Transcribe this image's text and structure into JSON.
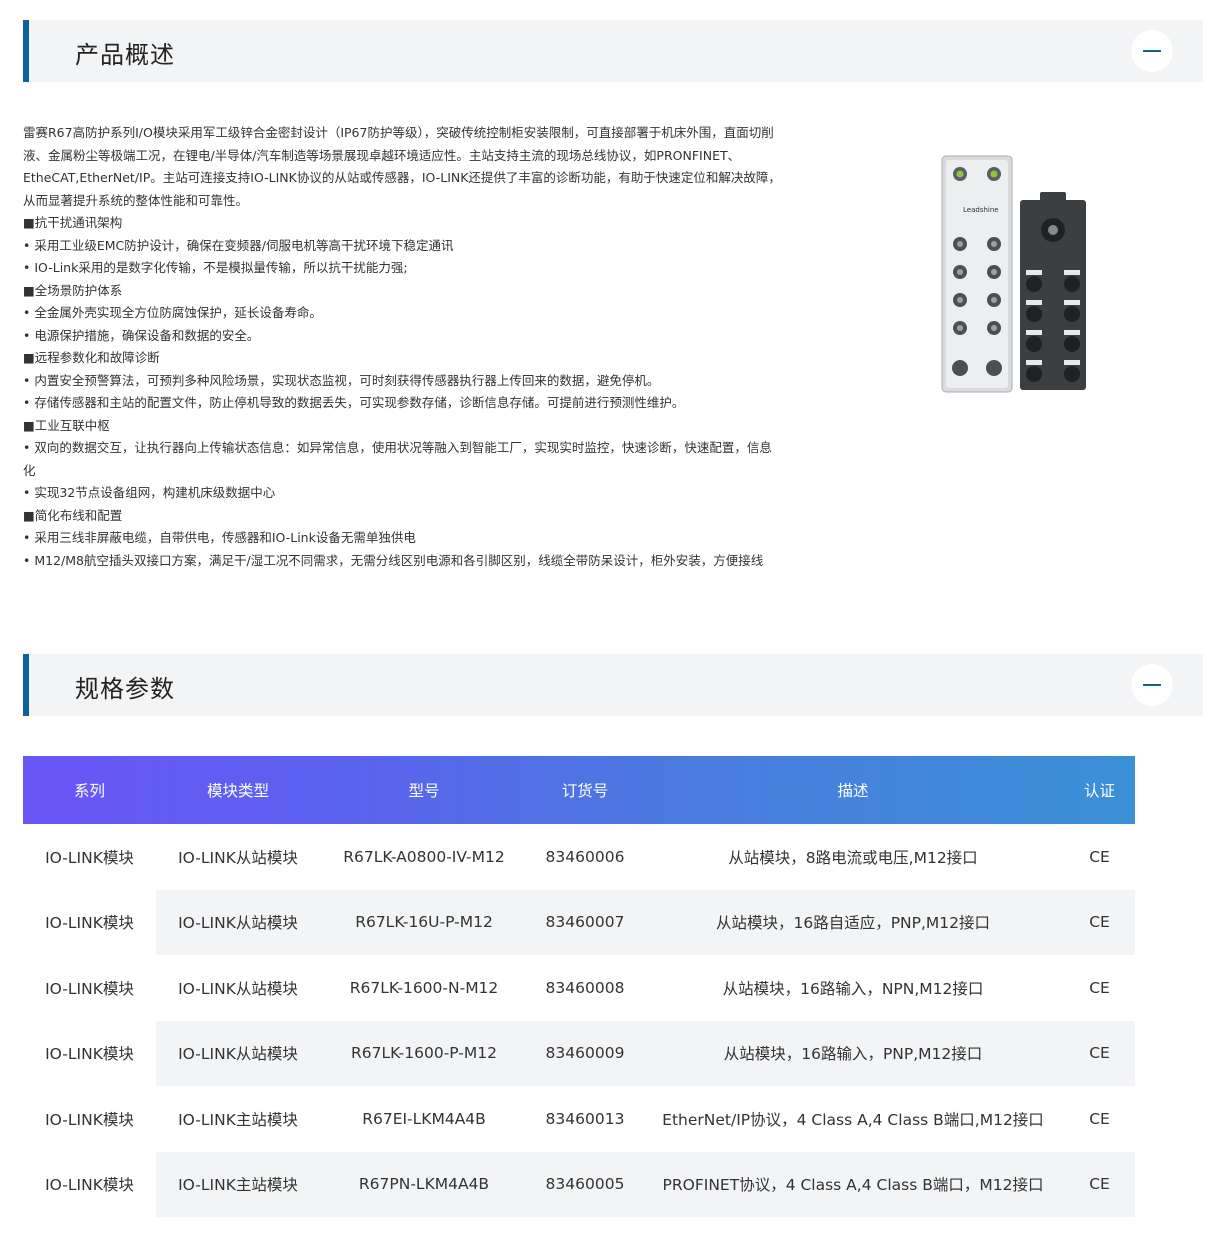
{
  "overview": {
    "title": "产品概述",
    "paragraphs": [
      "雷赛R67高防护系列I/O模块采用军工级锌合金密封设计（IP67防护等级），突破传统控制柜安装限制，可直接部署于机床外围，直面切削液、金属粉尘等极端工况，在锂电/半导体/汽车制造等场景展现卓越环境适应性。主站支持主流的现场总线协议，如PRONFINET、EtheCAT,EtherNet/IP。主站可连接支持IO-LINK协议的从站或传感器，IO-LINK还提供了丰富的诊断功能，有助于快速定位和解决故障，从而显著提升系统的整体性能和可靠性。",
      "■抗干扰通讯架构",
      "• 采用工业级EMC防护设计，确保在变频器/伺服电机等高干扰环境下稳定通讯",
      "•  IO-Link采用的是数字化传输，不是模拟量传输，所以抗干扰能力强;",
      "■全场景防护体系",
      "• 全金属外壳实现全方位防腐蚀保护，延长设备寿命。",
      "• 电源保护措施，确保设备和数据的安全。",
      "■远程参数化和故障诊断",
      "• 内置安全预警算法，可预判多种风险场景，实现状态监视，可时刻获得传感器执行器上传回来的数据，避免停机。",
      "• 存储传感器和主站的配置文件，防止停机导致的数据丢失，可实现参数存储，诊断信息存储。可提前进行预测性维护。",
      "■工业互联中枢",
      "• 双向的数据交互，让执行器向上传输状态信息：如异常信息，使用状况等融入到智能工厂，实现实时监控，快速诊断，快速配置，信息化",
      "• 实现32节点设备组网，构建机床级数据中心",
      "■简化布线和配置",
      "• 采用三线非屏蔽电缆，自带供电，传感器和IO-Link设备无需单独供电",
      "• M12/M8航空插头双接口方案，满足干/湿工况不同需求，无需分线区别电源和各引脚区别，线缆全带防呆设计，柜外安装，方便接线"
    ],
    "image_brand": "Leadshine"
  },
  "specs": {
    "title": "规格参数",
    "columns": [
      "系列",
      "模块类型",
      "型号",
      "订货号",
      "描述",
      "认证"
    ],
    "rows": [
      [
        "IO-LINK模块",
        "IO-LINK从站模块",
        "R67LK-A0800-IV-M12",
        "83460006",
        "从站模块，8路电流或电压,M12接口",
        "CE"
      ],
      [
        "IO-LINK模块",
        "IO-LINK从站模块",
        "R67LK-16U-P-M12",
        "83460007",
        "从站模块，16路自适应，PNP,M12接口",
        "CE"
      ],
      [
        "IO-LINK模块",
        "IO-LINK从站模块",
        "R67LK-1600-N-M12",
        "83460008",
        "从站模块，16路输入，NPN,M12接口",
        "CE"
      ],
      [
        "IO-LINK模块",
        "IO-LINK从站模块",
        "R67LK-1600-P-M12",
        "83460009",
        "从站模块，16路输入，PNP,M12接口",
        "CE"
      ],
      [
        "IO-LINK模块",
        "IO-LINK主站模块",
        "R67EI-LKM4A4B",
        "83460013",
        "EtherNet/IP协议，4 Class A,4 Class B端口,M12接口",
        "CE"
      ],
      [
        "IO-LINK模块",
        "IO-LINK主站模块",
        "R67PN-LKM4A4B",
        "83460005",
        "PROFINET协议，4 Class A,4 Class B端口，M12接口",
        "CE"
      ]
    ]
  },
  "colors": {
    "accent": "#0f5f9a",
    "header_gradient_start": "#6a55f7",
    "header_gradient_end": "#3a90d6",
    "row_stripe": "#f3f4f6"
  }
}
